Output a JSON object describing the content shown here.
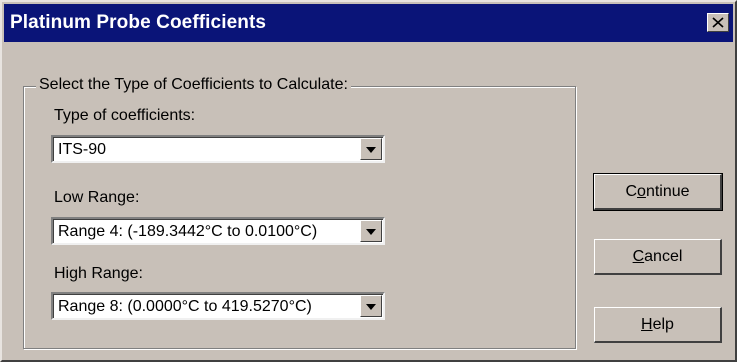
{
  "window": {
    "title": "Platinum Probe Coefficients",
    "close_icon": "close-icon"
  },
  "group": {
    "legend": "Select the Type of Coefficients to Calculate:",
    "type_label": "Type of coefficients:",
    "type_value": "ITS-90",
    "low_label": "Low Range:",
    "low_value": "Range 4:  (-189.3442°C to 0.0100°C)",
    "high_label": "High Range:",
    "high_value": "Range 8:  (0.0000°C to 419.5270°C)"
  },
  "buttons": {
    "continue": {
      "pre": "C",
      "accel": "o",
      "post": "ntinue"
    },
    "cancel": {
      "pre": "",
      "accel": "C",
      "post": "ancel"
    },
    "help": {
      "pre": "",
      "accel": "H",
      "post": "elp"
    }
  },
  "colors": {
    "title_bar": "#0a1478",
    "face": "#c8c0b8"
  }
}
